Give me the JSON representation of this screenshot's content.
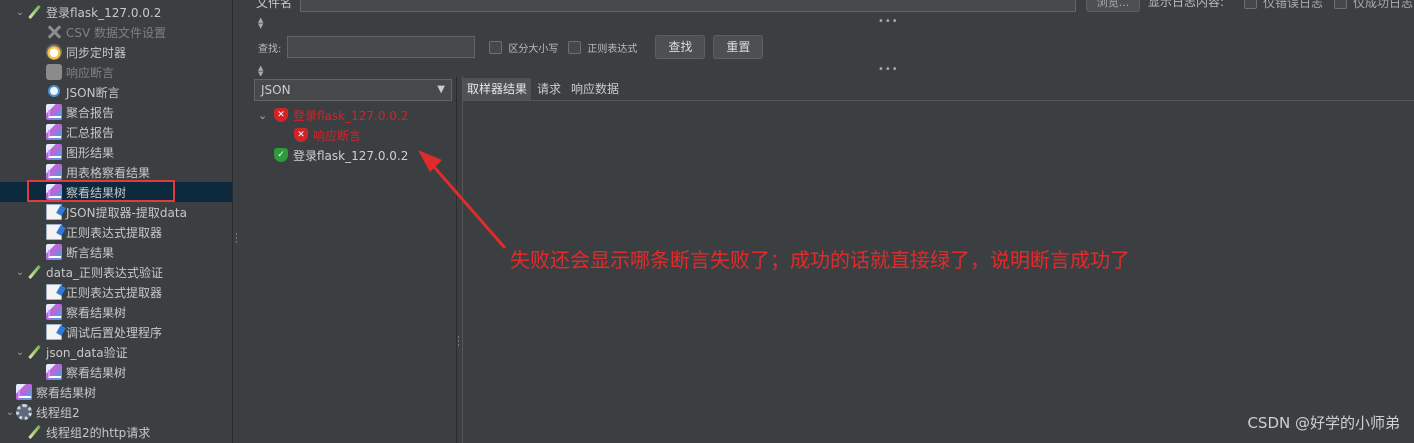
{
  "tree": {
    "items": [
      {
        "label": "登录flask_127.0.0.2",
        "icon": "pencil-icon",
        "indent": 1,
        "arrow": "⌄",
        "dim": false
      },
      {
        "label": "CSV 数据文件设置",
        "icon": "tools-icon",
        "indent": 2,
        "arrow": "",
        "dim": true
      },
      {
        "label": "同步定时器",
        "icon": "timer-icon",
        "indent": 2,
        "arrow": "",
        "dim": false
      },
      {
        "label": "响应断言",
        "icon": "assertion-icon",
        "indent": 2,
        "arrow": "",
        "dim": true
      },
      {
        "label": "JSON断言",
        "icon": "search-icon",
        "indent": 2,
        "arrow": "",
        "dim": false
      },
      {
        "label": "聚合报告",
        "icon": "report-icon",
        "indent": 2,
        "arrow": "",
        "dim": false
      },
      {
        "label": "汇总报告",
        "icon": "report-icon",
        "indent": 2,
        "arrow": "",
        "dim": false
      },
      {
        "label": "图形结果",
        "icon": "report-icon",
        "indent": 2,
        "arrow": "",
        "dim": false
      },
      {
        "label": "用表格察看结果",
        "icon": "report-icon",
        "indent": 2,
        "arrow": "",
        "dim": false
      },
      {
        "label": "察看结果树",
        "icon": "report-icon",
        "indent": 2,
        "arrow": "",
        "dim": false,
        "selected": true
      },
      {
        "label": "JSON提取器-提取data",
        "icon": "document-icon",
        "indent": 2,
        "arrow": "",
        "dim": false
      },
      {
        "label": "正则表达式提取器",
        "icon": "document-icon",
        "indent": 2,
        "arrow": "",
        "dim": false
      },
      {
        "label": "断言结果",
        "icon": "report-icon",
        "indent": 2,
        "arrow": "",
        "dim": false
      },
      {
        "label": "data_正则表达式验证",
        "icon": "pencil-icon",
        "indent": 1,
        "arrow": "⌄",
        "dim": false
      },
      {
        "label": "正则表达式提取器",
        "icon": "document-icon",
        "indent": 2,
        "arrow": "",
        "dim": false
      },
      {
        "label": "察看结果树",
        "icon": "report-icon",
        "indent": 2,
        "arrow": "",
        "dim": false
      },
      {
        "label": "调试后置处理程序",
        "icon": "document-icon",
        "indent": 2,
        "arrow": "",
        "dim": false
      },
      {
        "label": "json_data验证",
        "icon": "pencil-icon",
        "indent": 1,
        "arrow": "⌄",
        "dim": false
      },
      {
        "label": "察看结果树",
        "icon": "report-icon",
        "indent": 2,
        "arrow": "",
        "dim": false
      },
      {
        "label": "察看结果树",
        "icon": "report-icon",
        "indent": 0,
        "arrow": "",
        "dim": false
      },
      {
        "label": "线程组2",
        "icon": "gear-icon",
        "indent": 0,
        "arrow": "⌄",
        "dim": false
      },
      {
        "label": "线程组2的http请求",
        "icon": "pencil-icon",
        "indent": 1,
        "arrow": "",
        "dim": false
      }
    ]
  },
  "file": {
    "label": "文件名",
    "browse": "浏览...",
    "show_log": "显示日志内容:",
    "errors_only": "仅错误日志",
    "success_only": "仅成功日志"
  },
  "search": {
    "label": "查找:",
    "case_sensitive": "区分大小写",
    "regex": "正则表达式",
    "find_button": "查找",
    "reset_button": "重置"
  },
  "results": {
    "renderer": "JSON",
    "nodes": [
      {
        "label": "登录flask_127.0.0.2",
        "status": "fail",
        "level": 0
      },
      {
        "label": "响应断言",
        "status": "fail",
        "level": 1
      },
      {
        "label": "登录flask_127.0.0.2",
        "status": "ok",
        "level": 0
      }
    ]
  },
  "detail": {
    "tabs": [
      "取样器结果",
      "请求",
      "响应数据"
    ]
  },
  "annotation": "失败还会显示哪条断言失败了；成功的话就直接绿了，说明断言成功了",
  "watermark": "CSDN @好学的小师弟",
  "colors": {
    "fail": "#d0242b",
    "ok": "#2f9a3c",
    "annotation": "#e02b2b",
    "selected_row": "#0d293e"
  }
}
